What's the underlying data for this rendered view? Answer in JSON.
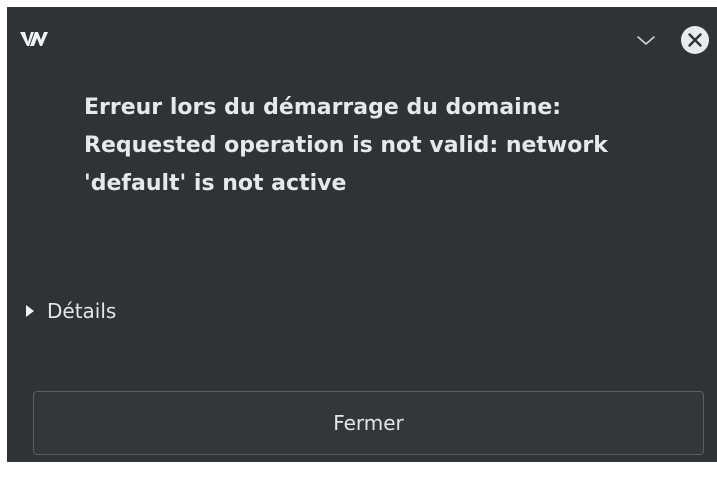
{
  "titlebar": {
    "app_icon": "virt-manager-logo-icon",
    "collapse_icon": "chevron-down-icon",
    "close_icon": "close-circle-icon"
  },
  "message": {
    "text": "Erreur lors du démarrage du domaine:\nRequested operation is not valid: network\n'default' is not active"
  },
  "details": {
    "label": "Détails",
    "icon": "triangle-right-icon"
  },
  "buttons": {
    "close_label": "Fermer"
  },
  "colors": {
    "background": "#2f3337",
    "text": "#e4e6e8",
    "button_border": "#5a5f64"
  }
}
